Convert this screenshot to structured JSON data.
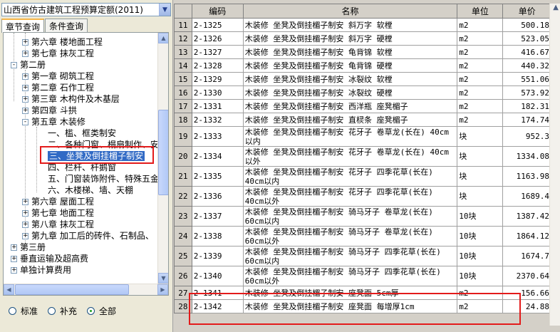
{
  "quota_selector": {
    "value": "山西省仿古建筑工程预算定额(2011)"
  },
  "tabs": [
    "章节查询",
    "条件查询"
  ],
  "tree": {
    "items": [
      {
        "label": "第六章 楼地面工程",
        "level": 2,
        "toggle": "+"
      },
      {
        "label": "第七章 抹灰工程",
        "level": 2,
        "toggle": "+"
      },
      {
        "label": "第二册",
        "level": 1,
        "toggle": "-"
      },
      {
        "label": "第一章 砌筑工程",
        "level": 2,
        "toggle": "+"
      },
      {
        "label": "第二章 石作工程",
        "level": 2,
        "toggle": "+"
      },
      {
        "label": "第三章 木构件及木基层",
        "level": 2,
        "toggle": "+"
      },
      {
        "label": "第四章 斗拱",
        "level": 2,
        "toggle": "+"
      },
      {
        "label": "第五章 木装修",
        "level": 2,
        "toggle": "-"
      },
      {
        "label": "一、槛、框类制安",
        "level": 3
      },
      {
        "label": "二、各种门窗、榻扇制作、安",
        "level": 3
      },
      {
        "label": "三、坐凳及倒挂楣子制安",
        "level": 3,
        "selected": true
      },
      {
        "label": "四、栏杆、杆鹅窗",
        "level": 3
      },
      {
        "label": "五、门窗装饰附件、特殊五金",
        "level": 3
      },
      {
        "label": "六、木楼梯、墙、天棚",
        "level": 3
      },
      {
        "label": "第六章 屋面工程",
        "level": 2,
        "toggle": "+"
      },
      {
        "label": "第七章 地面工程",
        "level": 2,
        "toggle": "+"
      },
      {
        "label": "第八章 抹灰工程",
        "level": 2,
        "toggle": "+"
      },
      {
        "label": "第九章 加工后的砖件、石制品、",
        "level": 2,
        "toggle": "+"
      },
      {
        "label": "第三册",
        "level": 1,
        "toggle": "+"
      },
      {
        "label": "垂直运输及超高费",
        "level": 1,
        "toggle": "+"
      },
      {
        "label": "单独计算费用",
        "level": 1,
        "toggle": "+"
      }
    ]
  },
  "filter": {
    "options": [
      "标准",
      "补充",
      "全部"
    ],
    "selected": "全部"
  },
  "grid": {
    "headers": [
      "编码",
      "名称",
      "单位",
      "单价"
    ],
    "rows": [
      {
        "idx": "11",
        "code": "2-1325",
        "name": "木装修 坐凳及倒挂楣子制安 斜万字 软樘",
        "unit": "m2",
        "price": "500.18"
      },
      {
        "idx": "12",
        "code": "2-1326",
        "name": "木装修 坐凳及倒挂楣子制安 斜万字 硬樘",
        "unit": "m2",
        "price": "523.05"
      },
      {
        "idx": "13",
        "code": "2-1327",
        "name": "木装修 坐凳及倒挂楣子制安 龟背锦 软樘",
        "unit": "m2",
        "price": "416.67"
      },
      {
        "idx": "14",
        "code": "2-1328",
        "name": "木装修 坐凳及倒挂楣子制安 龟背锦 硬樘",
        "unit": "m2",
        "price": "440.32"
      },
      {
        "idx": "15",
        "code": "2-1329",
        "name": "木装修 坐凳及倒挂楣子制安 冰裂纹 软樘",
        "unit": "m2",
        "price": "551.06"
      },
      {
        "idx": "16",
        "code": "2-1330",
        "name": "木装修 坐凳及倒挂楣子制安 冰裂纹 硬樘",
        "unit": "m2",
        "price": "573.92"
      },
      {
        "idx": "17",
        "code": "2-1331",
        "name": "木装修 坐凳及倒挂楣子制安 西洋瓶 座凳楣子",
        "unit": "m2",
        "price": "182.31"
      },
      {
        "idx": "18",
        "code": "2-1332",
        "name": "木装修 坐凳及倒挂楣子制安 直棂条 座凳楣子",
        "unit": "m2",
        "price": "174.74"
      },
      {
        "idx": "19",
        "code": "2-1333",
        "name": "木装修 坐凳及倒挂楣子制安 花牙子 卷草龙(长在) 40cm以内",
        "unit": "块",
        "price": "952.3"
      },
      {
        "idx": "20",
        "code": "2-1334",
        "name": "木装修 坐凳及倒挂楣子制安 花牙子 卷草龙(长在) 40cm以外",
        "unit": "块",
        "price": "1334.08"
      },
      {
        "idx": "21",
        "code": "2-1335",
        "name": "木装修 坐凳及倒挂楣子制安 花牙子 四季花草(长在) 40cm以内",
        "unit": "块",
        "price": "1163.98"
      },
      {
        "idx": "22",
        "code": "2-1336",
        "name": "木装修 坐凳及倒挂楣子制安 花牙子 四季花草(长在) 40cm以外",
        "unit": "块",
        "price": "1689.4"
      },
      {
        "idx": "23",
        "code": "2-1337",
        "name": "木装修 坐凳及倒挂楣子制安 骑马牙子 卷草龙(长在) 60cm以内",
        "unit": "10块",
        "price": "1387.42"
      },
      {
        "idx": "24",
        "code": "2-1338",
        "name": "木装修 坐凳及倒挂楣子制安 骑马牙子 卷草龙(长在) 60cm以外",
        "unit": "10块",
        "price": "1864.12"
      },
      {
        "idx": "25",
        "code": "2-1339",
        "name": "木装修 坐凳及倒挂楣子制安 骑马牙子 四季花草(长在) 60cm以内",
        "unit": "10块",
        "price": "1674.7"
      },
      {
        "idx": "26",
        "code": "2-1340",
        "name": "木装修 坐凳及倒挂楣子制安 骑马牙子 四季花草(长在) 60cm以外",
        "unit": "10块",
        "price": "2370.64"
      },
      {
        "idx": "27",
        "code": "2-1341",
        "name": "木装修 坐凳及倒挂楣子制安 座凳面 5cm厚",
        "unit": "m2",
        "price": "156.66"
      },
      {
        "idx": "28",
        "code": "2-1342",
        "name": "木装修 坐凳及倒挂楣子制安 座凳面 每增厚1cm",
        "unit": "m2",
        "price": "24.88"
      }
    ]
  },
  "colors": {
    "highlight_frame": "#e31b1b",
    "selection": "#316ac5"
  }
}
